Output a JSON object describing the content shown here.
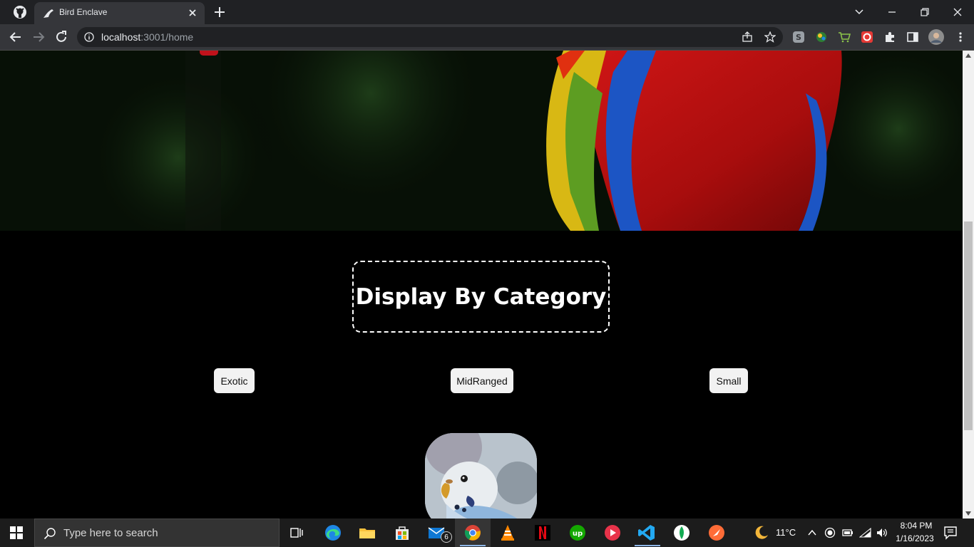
{
  "browser": {
    "tab_title": "Bird Enclave",
    "url_host": "localhost",
    "url_path": ":3001/home"
  },
  "page": {
    "category_heading": "Display By Category",
    "categories": [
      "Exotic",
      "MidRanged",
      "Small"
    ]
  },
  "taskbar": {
    "search_placeholder": "Type here to search",
    "mail_badge": "6",
    "weather_temp": "11°C",
    "time": "8:04 PM",
    "date": "1/16/2023"
  },
  "colors": {
    "page_bg": "#000000",
    "button_bg": "#f2f2f2",
    "chrome_dark": "#202124",
    "chrome_toolbar": "#35363a",
    "accent_red": "#c0121b"
  },
  "icons": {
    "tabbar": [
      "github-icon",
      "bird-favicon-icon",
      "close-icon",
      "plus-icon",
      "chevron-down-icon",
      "minimize-icon",
      "restore-icon",
      "close-window-icon"
    ],
    "toolbar": [
      "back-icon",
      "forward-icon",
      "reload-icon",
      "info-icon",
      "share-icon",
      "star-icon",
      "extension-skype-icon",
      "extension-globe-icon",
      "extension-cart-icon",
      "extension-red-icon",
      "puzzle-icon",
      "sidepanel-icon",
      "profile-avatar-icon",
      "menu-icon"
    ],
    "taskbar": [
      "windows-start-icon",
      "search-icon",
      "task-view-icon",
      "edge-icon",
      "file-explorer-icon",
      "store-icon",
      "mail-icon",
      "chrome-icon",
      "vlc-icon",
      "netflix-icon",
      "upwork-icon",
      "media-player-icon",
      "vscode-icon",
      "mongodb-icon",
      "postman-icon",
      "weather-moon-icon",
      "chevron-up-icon",
      "record-icon",
      "battery-icon",
      "wifi-icon",
      "volume-icon",
      "notification-icon"
    ]
  }
}
